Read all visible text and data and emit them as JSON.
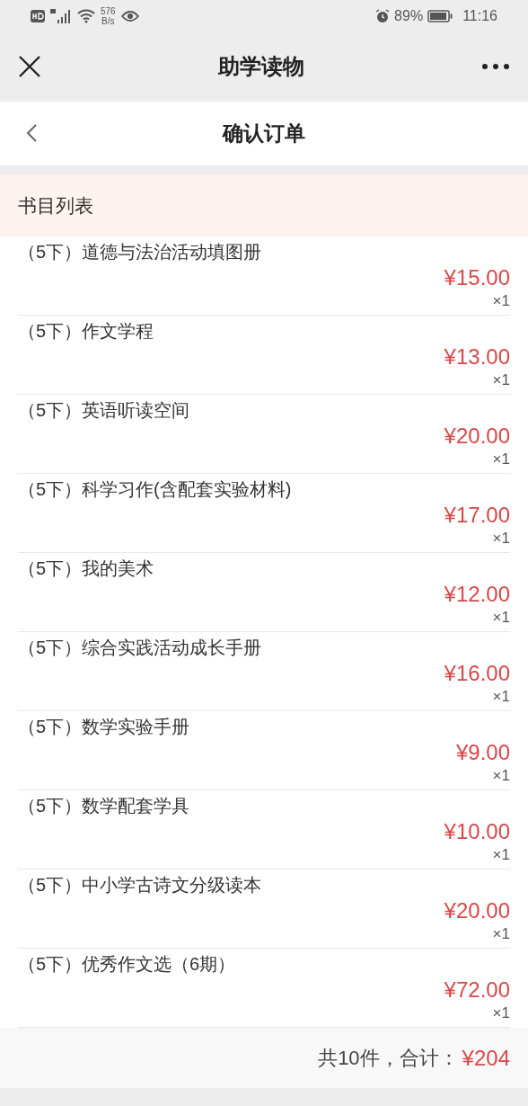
{
  "status_bar": {
    "network_speed": [
      "576",
      "B/s"
    ],
    "battery": "89%",
    "time": "11:16"
  },
  "nav_bar": {
    "title": "助学读物"
  },
  "page_header": {
    "title": "确认订单"
  },
  "section": {
    "title": "书目列表"
  },
  "items": [
    {
      "name": "（5下）道德与法治活动填图册",
      "price": "¥15.00",
      "quantity": "×1"
    },
    {
      "name": "（5下）作文学程",
      "price": "¥13.00",
      "quantity": "×1"
    },
    {
      "name": "（5下）英语听读空间",
      "price": "¥20.00",
      "quantity": "×1"
    },
    {
      "name": "（5下）科学习作(含配套实验材料)",
      "price": "¥17.00",
      "quantity": "×1"
    },
    {
      "name": "（5下）我的美术",
      "price": "¥12.00",
      "quantity": "×1"
    },
    {
      "name": "（5下）综合实践活动成长手册",
      "price": "¥16.00",
      "quantity": "×1"
    },
    {
      "name": "（5下）数学实验手册",
      "price": "¥9.00",
      "quantity": "×1"
    },
    {
      "name": "（5下）数学配套学具",
      "price": "¥10.00",
      "quantity": "×1"
    },
    {
      "name": "（5下）中小学古诗文分级读本",
      "price": "¥20.00",
      "quantity": "×1"
    },
    {
      "name": "（5下）优秀作文选（6期）",
      "price": "¥72.00",
      "quantity": "×1"
    }
  ],
  "footer": {
    "summary": "共10件，合计：",
    "total": "¥204"
  }
}
